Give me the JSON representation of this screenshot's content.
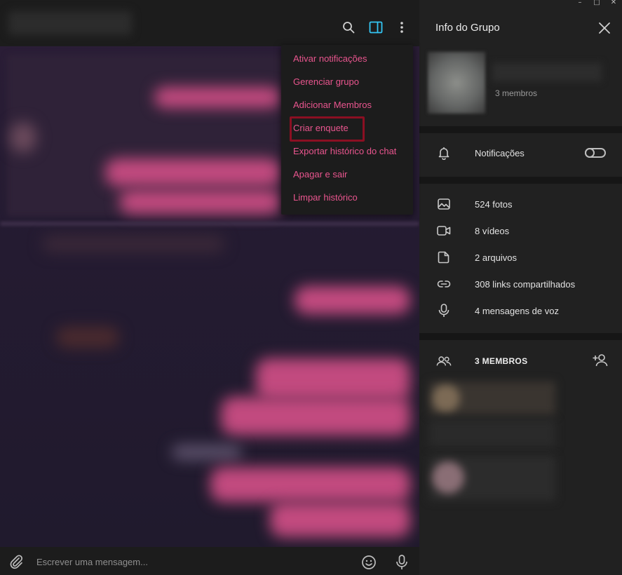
{
  "window": {
    "controls": [
      "–",
      "□",
      "✕"
    ]
  },
  "chat": {
    "composer_placeholder": "Escrever uma mensagem..."
  },
  "menu": {
    "items": [
      {
        "label": "Ativar notificações"
      },
      {
        "label": "Gerenciar grupo"
      },
      {
        "label": "Adicionar Membros"
      },
      {
        "label": "Criar enquete",
        "highlighted": true
      },
      {
        "label": "Exportar histórico do chat"
      },
      {
        "label": "Apagar e sair"
      },
      {
        "label": "Limpar histórico"
      }
    ]
  },
  "panel": {
    "title": "Info do Grupo",
    "group": {
      "members_count": "3 membros"
    },
    "notifications": {
      "label": "Notificações",
      "enabled": false
    },
    "media": [
      {
        "icon": "photo-icon",
        "label": "524 fotos"
      },
      {
        "icon": "video-icon",
        "label": "8 vídeos"
      },
      {
        "icon": "file-icon",
        "label": "2 arquivos"
      },
      {
        "icon": "link-icon",
        "label": "308 links compartilhados"
      },
      {
        "icon": "microphone-icon",
        "label": "4 mensagens de voz"
      }
    ],
    "members_header": "3 MEMBROS"
  },
  "colors": {
    "accent": "#e9558e",
    "highlight_box": "#8b0f22",
    "panel_bg": "#212121",
    "active_icon": "#34c6f4"
  }
}
